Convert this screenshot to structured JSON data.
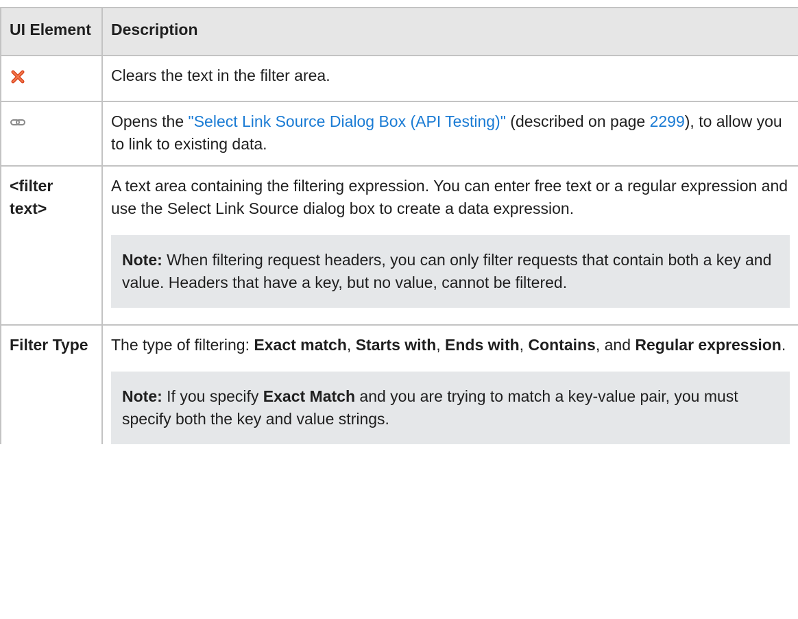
{
  "table": {
    "header": {
      "col1": "UI Element",
      "col2": "Description"
    },
    "rows": [
      {
        "icon": "clear-x-icon",
        "description": "Clears the text in the filter area."
      },
      {
        "icon": "link-icon",
        "desc_before": "Opens the ",
        "link_text": "\"Select Link Source Dialog Box (API Testing)\"",
        "desc_middle": " (described on page ",
        "page_link": "2299",
        "desc_after": "), to allow you to link to existing data."
      },
      {
        "element": "<filter text>",
        "description": "A text area containing the filtering expression. You can enter free text or a regular expression and use the Select Link Source dialog box to create a data expression.",
        "note_label": "Note:",
        "note_text": " When filtering request headers, you can only filter requests that contain both a key and value. Headers that have a key, but no value, cannot be filtered."
      },
      {
        "element": "Filter Type",
        "desc_intro": "The type of filtering: ",
        "opt1": "Exact match",
        "sep1": ", ",
        "opt2": "Starts with",
        "sep2": ", ",
        "opt3": "Ends with",
        "sep3": ", ",
        "opt4": "Contains",
        "sep4": ", and ",
        "opt5": "Regular expression",
        "end": ".",
        "note_label": "Note:",
        "note_pre": " If you specify ",
        "note_bold": "Exact Match",
        "note_post": " and you are trying to match a key-value pair, you must specify both the key and value strings."
      }
    ]
  },
  "colors": {
    "link": "#1a7bd4",
    "header_bg": "#e6e6e6",
    "note_bg": "#e5e7e9",
    "border": "#c3c3c3",
    "icon_red": "#e8502a"
  }
}
